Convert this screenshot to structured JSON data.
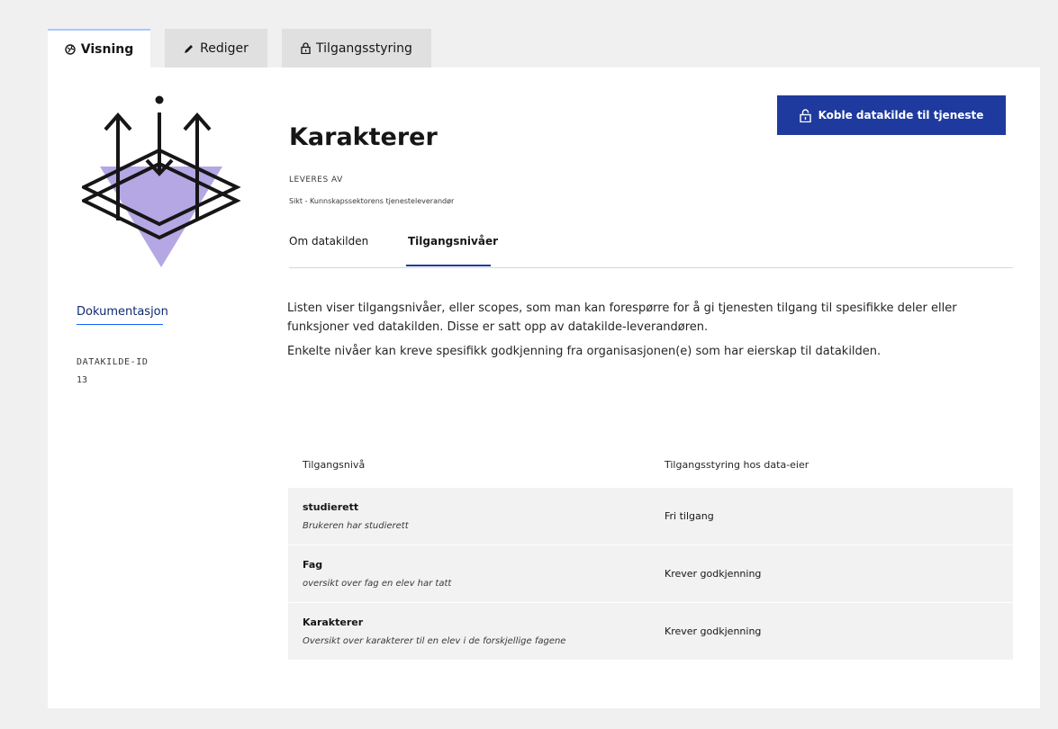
{
  "tabs": {
    "view": "Visning",
    "edit": "Rediger",
    "access": "Tilgangsstyring"
  },
  "actions": {
    "connect": "Koble datakilde til tjeneste"
  },
  "datasource": {
    "title": "Karakterer",
    "provided_by_label": "LEVERES AV",
    "provided_by": "Sikt - Kunnskapssektorens tjenesteleverandør"
  },
  "sidebar": {
    "documentation": "Dokumentasjon",
    "id_label": "DATAKILDE-ID",
    "id_value": "13"
  },
  "subtabs": {
    "about": "Om datakilden",
    "levels": "Tilgangsnivåer"
  },
  "description": {
    "p1": "Listen viser tilgangsnivåer, eller scopes, som man kan forespørre for å gi tjenesten tilgang til spesifikke deler eller funksjoner ved datakilden. Disse er satt opp av datakilde-leverandøren.",
    "p2": "Enkelte nivåer kan kreve spesifikk godkjenning fra organisasjonen(e) som har eierskap til datakilden."
  },
  "table": {
    "headers": [
      "Tilgangsnivå",
      "Tilgangsstyring hos data-eier"
    ],
    "rows": [
      {
        "name": "studierett",
        "description": "Brukeren har studierett",
        "access": "Fri tilgang"
      },
      {
        "name": "Fag",
        "description": "oversikt over fag en elev har tatt",
        "access": "Krever godkjenning"
      },
      {
        "name": "Karakterer",
        "description": "Oversikt over karakterer til en elev i de forskjellige fagene",
        "access": "Krever godkjenning"
      }
    ]
  },
  "colors": {
    "primary_button": "#1f3a9e",
    "logo_triangle": "#b4a7e3",
    "active_tab_top": "#a6c8ff",
    "row_bg": "#f2f2f2"
  }
}
